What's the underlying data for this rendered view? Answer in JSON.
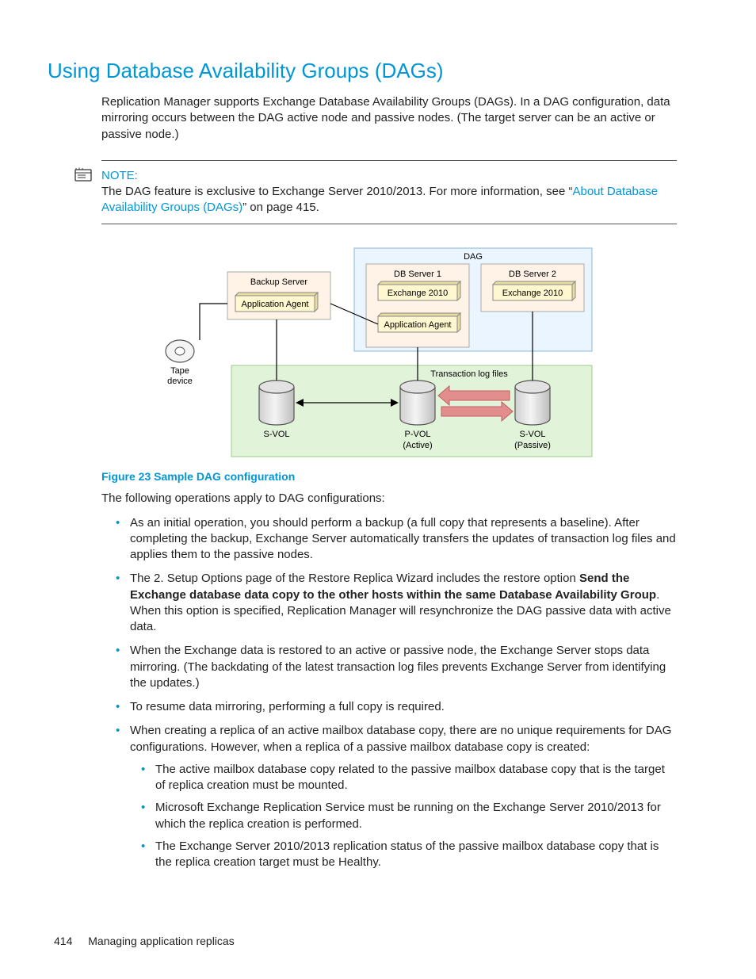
{
  "heading": "Using Database Availability Groups (DAGs)",
  "intro": "Replication Manager supports Exchange Database Availability Groups (DAGs). In a DAG configuration, data mirroring occurs between the DAG active node and passive nodes. (The target server can be an active or passive node.)",
  "note": {
    "label": "NOTE:",
    "text_before_link": "The DAG feature is exclusive to Exchange Server 2010/2013. For more information, see “",
    "link_text": "About Database Availability Groups (DAGs)",
    "text_after_link": "” on page 415."
  },
  "diagram": {
    "dag": "DAG",
    "db1": "DB Server 1",
    "db2": "DB Server 2",
    "ex1": "Exchange 2010",
    "ex2": "Exchange 2010",
    "app_agent_right": "Application Agent",
    "backup_server": "Backup Server",
    "app_agent_left": "Application Agent",
    "tape": "Tape device",
    "txlog": "Transaction log files",
    "svol_left": "S-VOL",
    "pvol": "P-VOL",
    "pvol_sub": "(Active)",
    "svol_right": "S-VOL",
    "svol_right_sub": "(Passive)"
  },
  "figure_caption": "Figure 23 Sample DAG configuration",
  "operations_intro": "The following operations apply to DAG configurations:",
  "bullets": [
    {
      "text": "As an initial operation, you should perform a backup (a full copy that represents a baseline). After completing the backup, Exchange Server automatically transfers the updates of transaction log files and applies them to the passive nodes."
    },
    {
      "prefix": "The 2. Setup Options page of the Restore Replica Wizard includes the restore option ",
      "bold": "Send the Exchange database data copy to the other hosts within the same Database Availability Group",
      "suffix": ". When this option is specified, Replication Manager will resynchronize the DAG passive data with active data."
    },
    {
      "text": "When the Exchange data is restored to an active or passive node, the Exchange Server stops data mirroring. (The backdating of the latest transaction log files prevents Exchange Server from identifying the updates.)"
    },
    {
      "text": "To resume data mirroring, performing a full copy is required."
    },
    {
      "text": "When creating a replica of an active mailbox database copy, there are no unique requirements for DAG configurations. However, when a replica of a passive mailbox database copy is created:",
      "sub": [
        "The active mailbox database copy related to the passive mailbox database copy that is the target of replica creation must be mounted.",
        "Microsoft Exchange Replication Service must be running on the Exchange Server 2010/2013 for which the replica creation is performed.",
        "The Exchange Server 2010/2013 replication status of the passive mailbox database copy that is the replica creation target must be Healthy."
      ]
    }
  ],
  "footer": {
    "page": "414",
    "section": "Managing application replicas"
  }
}
